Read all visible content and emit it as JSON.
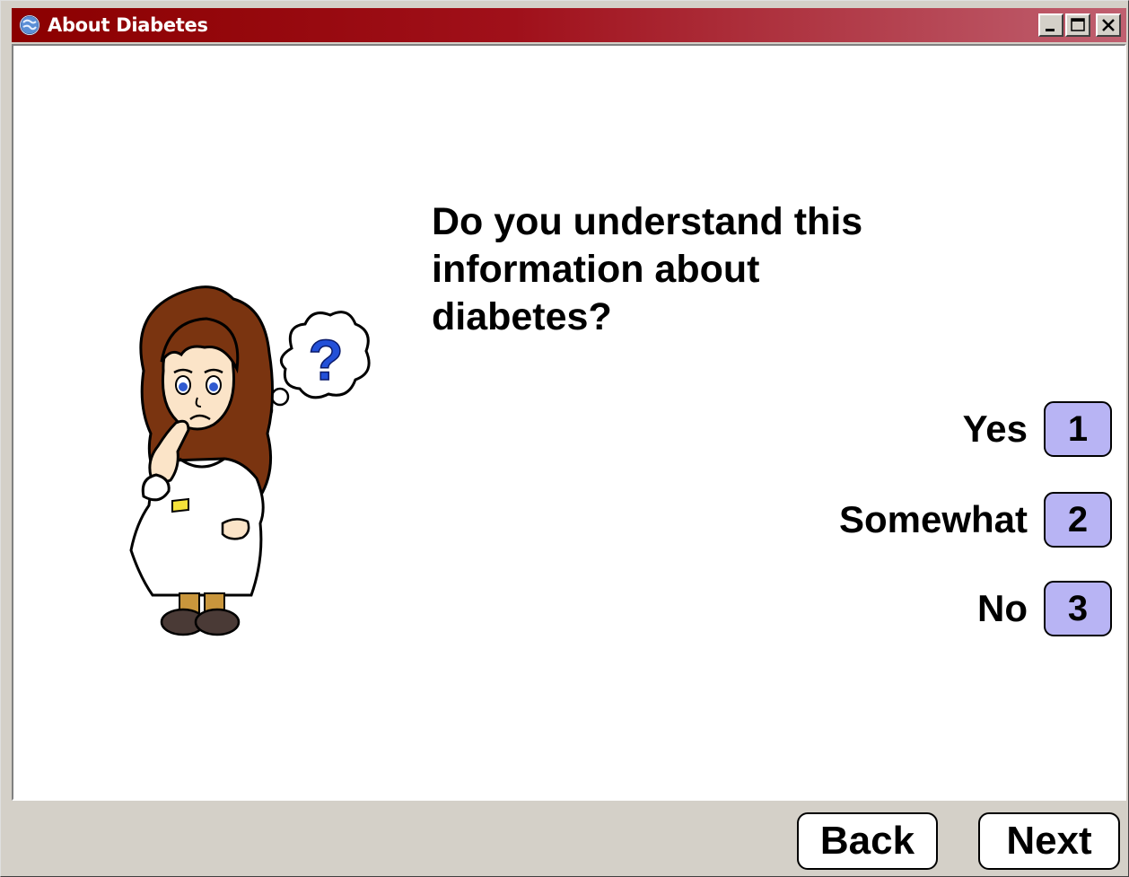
{
  "window": {
    "title": "About Diabetes",
    "title_icon": "app-globe-icon",
    "controls": [
      "minimize-icon",
      "maximize-icon",
      "close-icon"
    ]
  },
  "main": {
    "question": "Do you understand this information about diabetes?",
    "illustration": "confused-woman-with-question-thought-bubble",
    "answers": [
      {
        "label": "Yes",
        "key": "1"
      },
      {
        "label": "Somewhat",
        "key": "2"
      },
      {
        "label": "No",
        "key": "3"
      }
    ]
  },
  "footer": {
    "back_label": "Back",
    "next_label": "Next"
  },
  "colors": {
    "titlebar_start": "#8b0000",
    "titlebar_end": "#c06070",
    "answer_key_fill": "#b8b4f4",
    "chrome": "#d4d0c8"
  }
}
